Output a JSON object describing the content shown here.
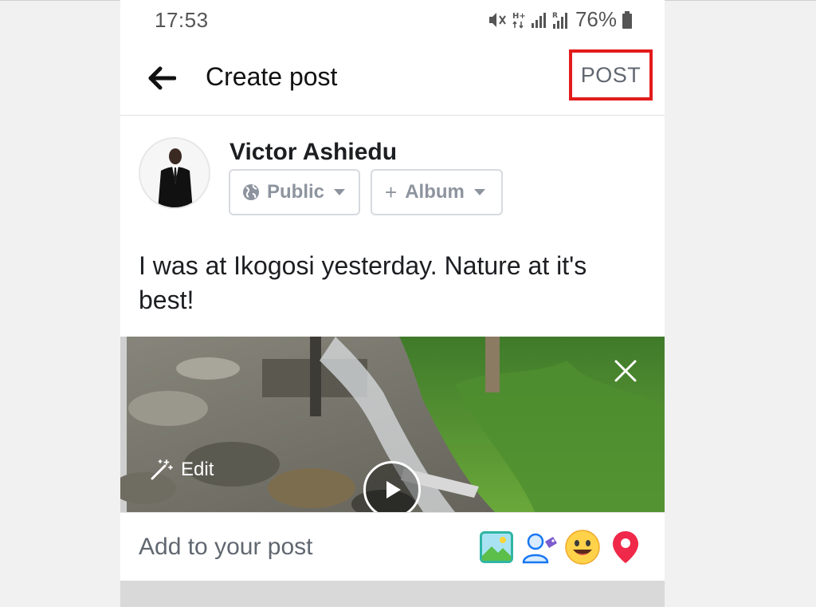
{
  "status_bar": {
    "time": "17:53",
    "battery": "76%",
    "icons": [
      "mute-icon",
      "hplus-signal-icon",
      "signal-icon",
      "roaming-signal-icon",
      "battery-icon"
    ]
  },
  "header": {
    "back_icon": "arrow-left-icon",
    "title": "Create post",
    "post_label": "POST",
    "highlight_color": "#e21b1b"
  },
  "composer": {
    "author_name": "Victor Ashiedu",
    "privacy_label": "Public",
    "album_label": "Album",
    "post_text_line1": "I was at Ikogosi yesterday. Nature at it's",
    "post_text_line2": "best!"
  },
  "media": {
    "edit_label": "Edit",
    "icons": [
      "close-icon",
      "magic-wand-icon",
      "play-icon"
    ]
  },
  "add_to_post": {
    "label": "Add to your post",
    "icons": [
      "photo-icon",
      "tag-people-icon",
      "feeling-icon",
      "location-icon"
    ]
  }
}
